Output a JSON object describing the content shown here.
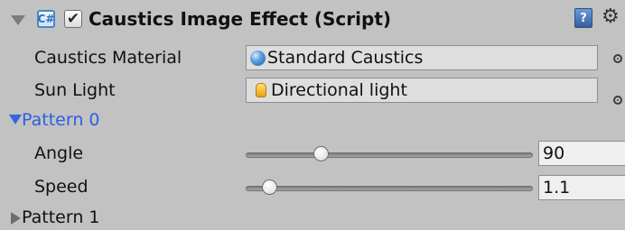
{
  "header": {
    "title": "Caustics Image Effect (Script)",
    "script_icon": "script-icon",
    "enabled_checked": true,
    "checkbox_mark": "✔",
    "help_icon": "help-book-icon",
    "settings_icon": "gear-icon",
    "settings_glyph": "⚙"
  },
  "properties": {
    "caustics_material": {
      "label": "Caustics Material",
      "value": "Standard Caustics",
      "icon": "material-sphere-icon"
    },
    "sun_light": {
      "label": "Sun Light",
      "value": "Directional light",
      "icon": "light-bulb-icon"
    }
  },
  "pattern0": {
    "label": "Pattern 0",
    "expanded": true,
    "angle": {
      "label": "Angle",
      "value": "90",
      "level": 0.25
    },
    "speed": {
      "label": "Speed",
      "value": "1.1",
      "level": 0.06
    }
  },
  "pattern1": {
    "label": "Pattern 1",
    "expanded": false
  },
  "colors": {
    "background": "#c2c2c2",
    "foldout_active": "#2d5fe0"
  }
}
